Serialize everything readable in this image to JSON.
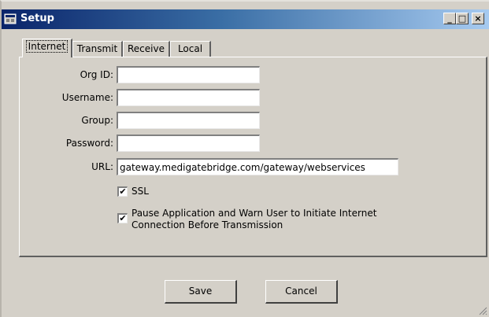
{
  "window": {
    "title": "Setup",
    "minimize_symbol": "_",
    "maximize_symbol": "□",
    "close_symbol": "×"
  },
  "tabs": [
    {
      "label": "Internet",
      "active": true
    },
    {
      "label": "Transmit",
      "active": false
    },
    {
      "label": "Receive",
      "active": false
    },
    {
      "label": "Local",
      "active": false
    }
  ],
  "form": {
    "org_id": {
      "label": "Org ID:",
      "value": ""
    },
    "username": {
      "label": "Username:",
      "value": ""
    },
    "group": {
      "label": "Group:",
      "value": ""
    },
    "password": {
      "label": "Password:",
      "value": ""
    },
    "url": {
      "label": "URL:",
      "value": "gateway.medigatebridge.com/gateway/webservices"
    }
  },
  "options": {
    "ssl": {
      "label": "SSL",
      "checked": true
    },
    "pause_warn": {
      "label_line1": "Pause Application and Warn User to Initiate Internet",
      "label_line2": "Connection Before Transmission",
      "checked": true
    }
  },
  "buttons": {
    "save": "Save",
    "cancel": "Cancel"
  },
  "icons": {
    "app": "setup-window-icon",
    "checkmark": "✔"
  }
}
